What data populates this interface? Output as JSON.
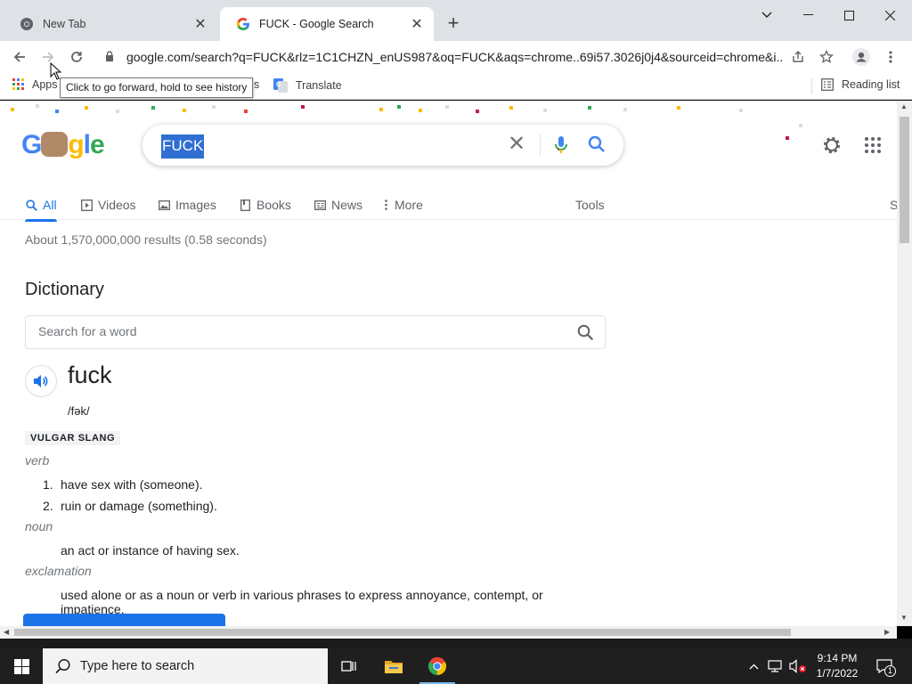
{
  "browser": {
    "tabs": [
      {
        "title": "New Tab",
        "active": false
      },
      {
        "title": "FUCK - Google Search",
        "active": true
      }
    ],
    "url": "google.com/search?q=FUCK&rlz=1C1CHZN_enUS987&oq=FUCK&aqs=chrome..69i57.3026j0j4&sourceid=chrome&i...",
    "tooltip": "Click to go forward, hold to see history",
    "bookmarks": {
      "apps_label": "Apps",
      "hidden_suffix": "s",
      "translate_label": "Translate",
      "reading_list_label": "Reading list"
    }
  },
  "search": {
    "query": "FUCK",
    "tabs": [
      {
        "label": "All",
        "icon": "search-icon",
        "active": true
      },
      {
        "label": "Videos",
        "icon": "video-icon",
        "active": false
      },
      {
        "label": "Images",
        "icon": "image-icon",
        "active": false
      },
      {
        "label": "Books",
        "icon": "book-icon",
        "active": false
      },
      {
        "label": "News",
        "icon": "news-icon",
        "active": false
      },
      {
        "label": "More",
        "icon": "more-vert-icon",
        "active": false
      }
    ],
    "tools_label": "Tools",
    "right_edge_label": "S",
    "result_stats": "About 1,570,000,000 results (0.58 seconds)"
  },
  "dictionary": {
    "title": "Dictionary",
    "search_placeholder": "Search for a word",
    "word": "fuck",
    "phonetic": "/fək/",
    "register": "VULGAR SLANG",
    "senses": [
      {
        "pos": "verb",
        "definitions": [
          "have sex with (someone).",
          "ruin or damage (something)."
        ]
      },
      {
        "pos": "noun",
        "definitions": [
          "an act or instance of having sex."
        ]
      },
      {
        "pos": "exclamation",
        "definitions": [
          "used alone or as a noun or verb in various phrases to express annoyance, contempt, or impatience."
        ]
      }
    ],
    "numbers": [
      "1.",
      "2."
    ]
  },
  "taskbar": {
    "search_placeholder": "Type here to search",
    "time": "9:14 PM",
    "date": "1/7/2022",
    "notification_count": "1"
  },
  "colors": {
    "accent": "#1a73e8",
    "query_highlight": "#2f6fd1",
    "tabstrip": "#dee1e6",
    "taskbar": "#1f1f1f"
  }
}
